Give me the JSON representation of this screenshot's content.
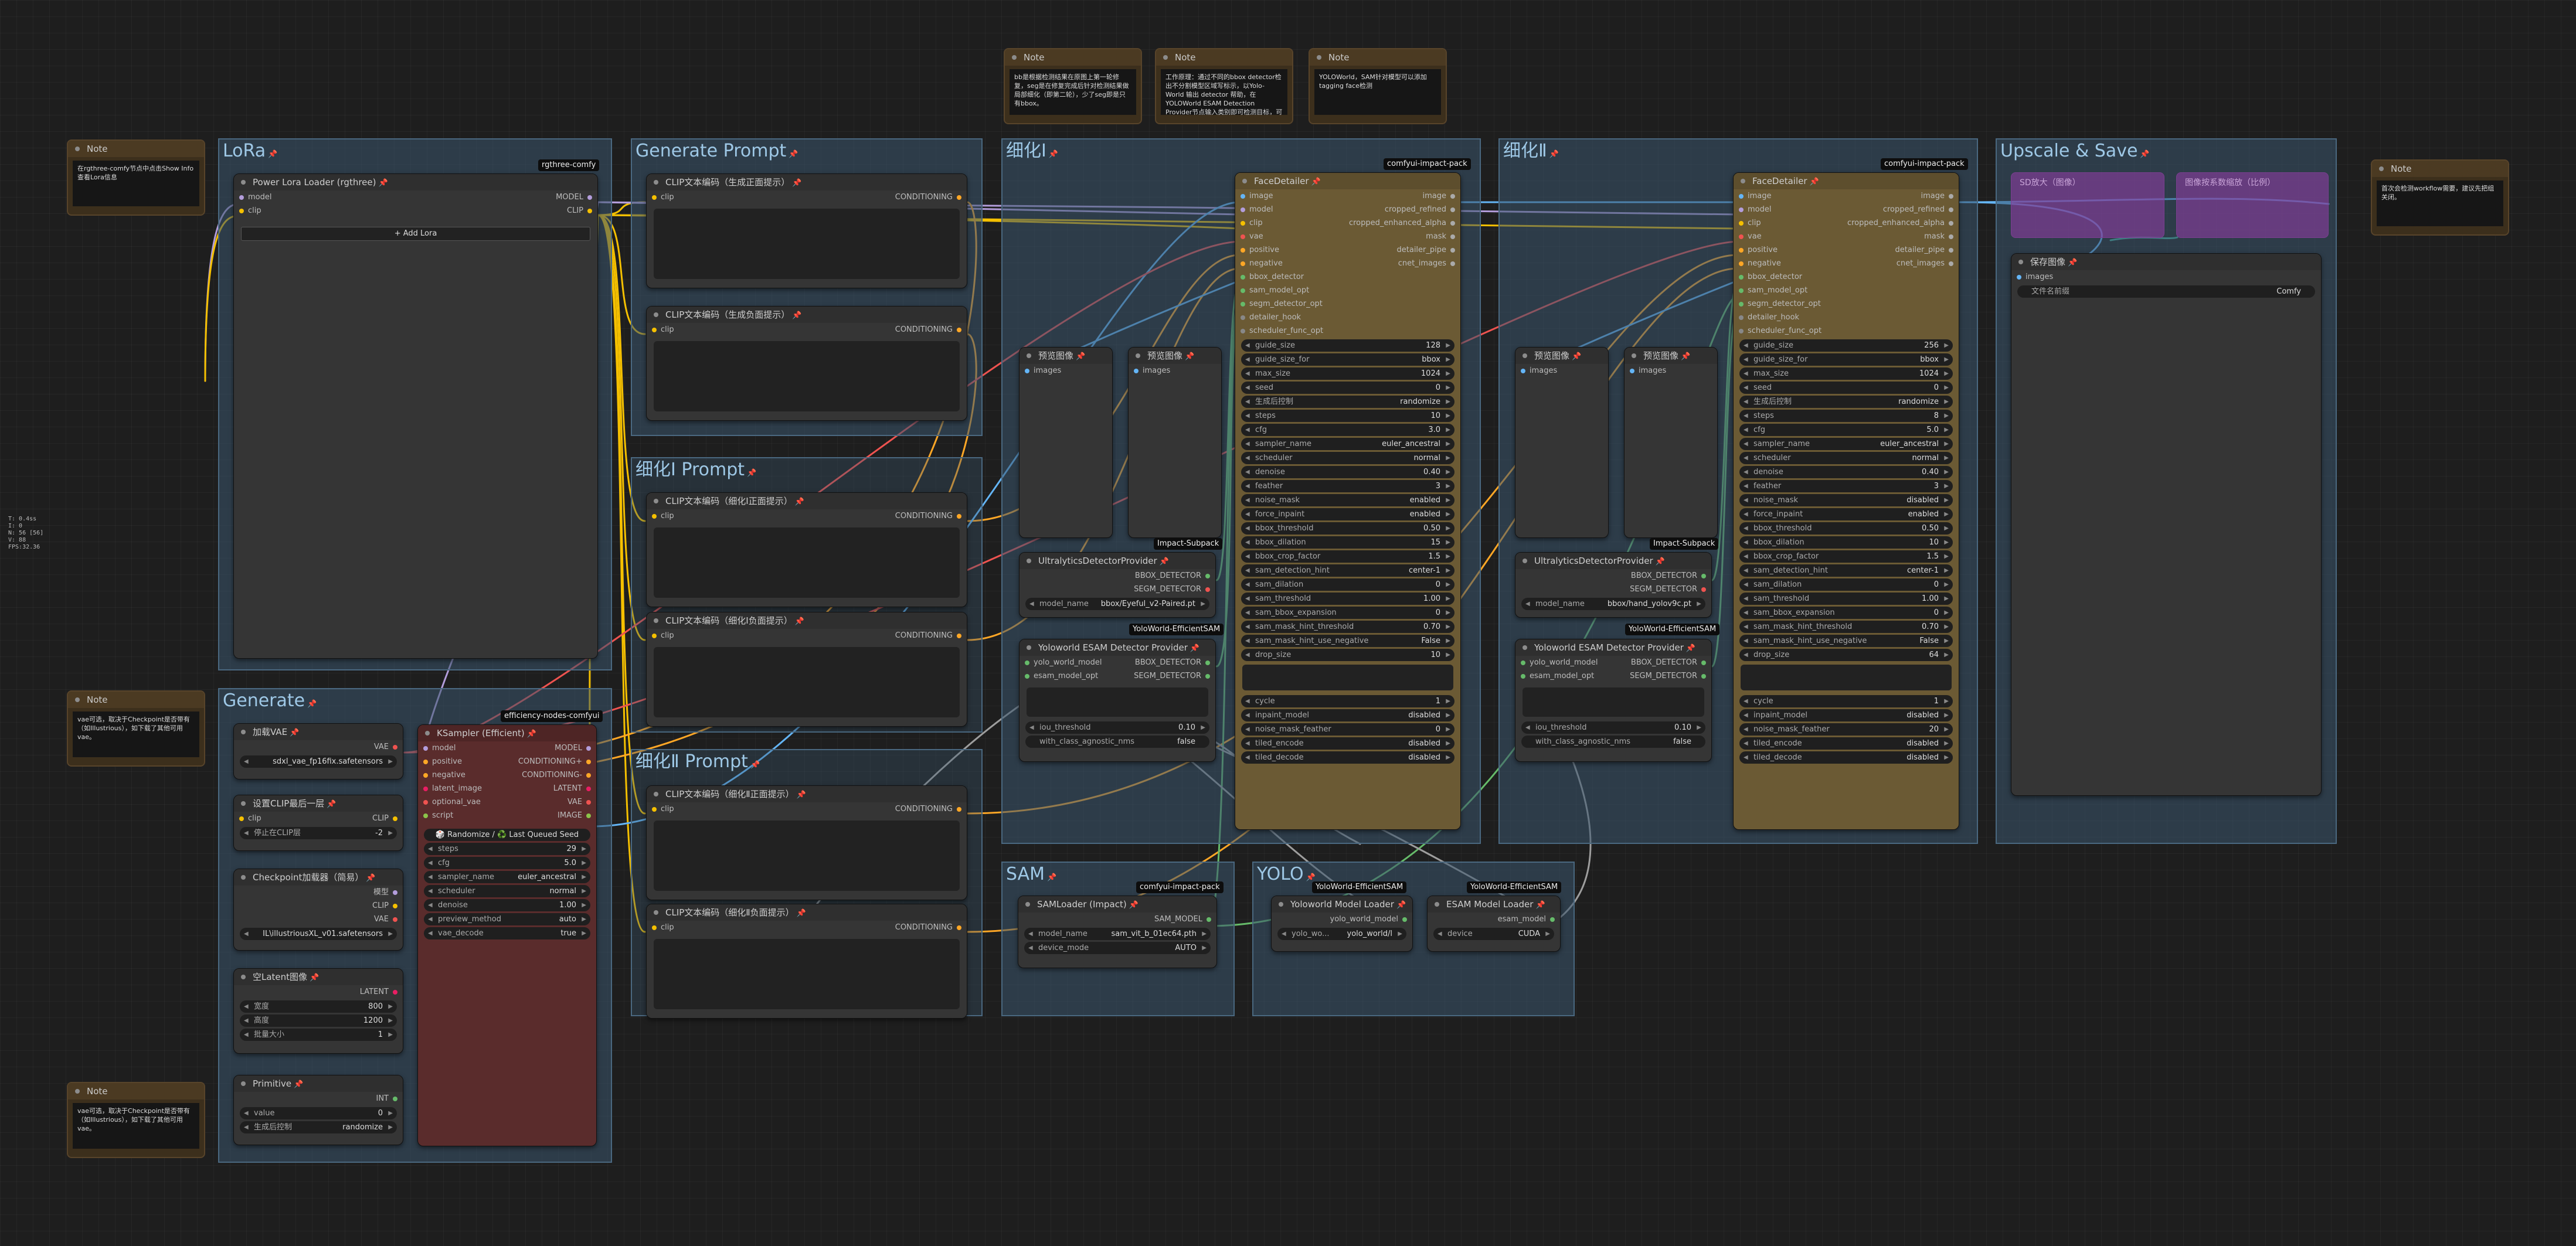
{
  "stats": {
    "line1": "T: 0.4ss",
    "line2": "I: 0",
    "line3": "N: 56 [56]",
    "line4": "V: 88",
    "line5": "FPS:32.36"
  },
  "groups": {
    "lora": "LoRa",
    "generate_prompt": "Generate Prompt",
    "refine1": "细化Ⅰ",
    "refine2": "细化Ⅱ",
    "upscale": "Upscale & Save",
    "refine1_prompt": "细化Ⅰ Prompt",
    "refine2_prompt": "细化Ⅱ Prompt",
    "generate": "Generate",
    "sam": "SAM",
    "yolo": "YOLO"
  },
  "notes": {
    "title": "Note",
    "top_left": "在rgthree-comfy节点中点击Show Info查看Lora信息",
    "mid_left": "vae可选，取决于Checkpoint是否带有（如Illustrious），如下载了其他可用vae。",
    "bot_left": "vae可选，取决于Checkpoint是否带有（如Illustrious），如下载了其他可用vae。",
    "top1": "bb是根据检测结果在原图上第一轮修复，seg是在修复完成后针对检测结果做局部细化（即第二轮），少了seg即是只有bbox。",
    "top2": "工作原理：通过不同的bbox detector检出不分割模型区域写标示，以Yolo-World 输出 detector 帮助，在YOLOWorld ESAM Detection Provider节点输入类别即可检测目标，可将其多个类目合并以逗号分隔。",
    "top3": "YOLOWorld，SAM针对模型可以添加tagging face检测",
    "right": "首次会检测workflow需要，建议先把组关闭。"
  },
  "badges": {
    "rgthree": "rgthree-comfy",
    "impact": "comfyui-impact-pack",
    "efficiency": "efficiency-nodes-comfyui",
    "impact_subpack": "Impact-Subpack",
    "yoloworld": "YoloWorld-EfficientSAM"
  },
  "lora": {
    "title": "Power Lora Loader (rgthree)",
    "in_model": "model",
    "in_clip": "clip",
    "out_model": "MODEL",
    "out_clip": "CLIP",
    "add_lora": "+ Add Lora"
  },
  "clip": {
    "pos_gen": "CLIP文本编码（生成正面提示）",
    "neg_gen": "CLIP文本编码（生成负面提示）",
    "pos_r1": "CLIP文本编码（细化Ⅰ正面提示）",
    "neg_r1": "CLIP文本编码（细化Ⅰ负面提示）",
    "pos_r2": "CLIP文本编码（细化Ⅱ正面提示）",
    "neg_r2": "CLIP文本编码（细化Ⅱ负面提示）",
    "in": "clip",
    "out": "CONDITIONING"
  },
  "generate": {
    "vae_loader": {
      "title": "加载VAE",
      "out": "VAE",
      "name": "sdxl_vae_fp16fix.safetensors"
    },
    "clip_skip": {
      "title": "设置CLIP最后一层",
      "in": "clip",
      "out": "CLIP",
      "label": "停止在CLIP层",
      "value": "-2"
    },
    "ckpt": {
      "title": "Checkpoint加载器（简易）",
      "out_model": "模型",
      "out_clip": "CLIP",
      "out_vae": "VAE",
      "name": "IL\\illustriousXL_v01.safetensors"
    },
    "latent": {
      "title": "空Latent图像",
      "out": "LATENT",
      "w_label": "宽度",
      "w": "800",
      "h_label": "高度",
      "h": "1200",
      "b_label": "批量大小",
      "b": "1"
    },
    "primitive": {
      "title": "Primitive",
      "out": "INT",
      "v_label": "value",
      "v": "0",
      "c_label": "生成后控制",
      "c": "randomize"
    }
  },
  "ksampler": {
    "title": "KSampler (Efficient)",
    "inputs": [
      "model",
      "positive",
      "negative",
      "latent_image",
      "optional_vae",
      "script"
    ],
    "outputs": [
      "MODEL",
      "CONDITIONING+",
      "CONDITIONING-",
      "LATENT",
      "VAE",
      "IMAGE"
    ],
    "seed_btn": "🎲 Randomize / ♻️ Last Queued Seed",
    "widgets": [
      {
        "l": "steps",
        "v": "29"
      },
      {
        "l": "cfg",
        "v": "5.0"
      },
      {
        "l": "sampler_name",
        "v": "euler_ancestral"
      },
      {
        "l": "scheduler",
        "v": "normal"
      },
      {
        "l": "denoise",
        "v": "1.00"
      },
      {
        "l": "preview_method",
        "v": "auto"
      },
      {
        "l": "vae_decode",
        "v": "true"
      }
    ]
  },
  "face1": {
    "title": "FaceDetailer",
    "inputs": [
      "image",
      "model",
      "clip",
      "vae",
      "positive",
      "negative",
      "bbox_detector",
      "sam_model_opt",
      "segm_detector_opt",
      "detailer_hook",
      "scheduler_func_opt"
    ],
    "outputs": [
      "image",
      "cropped_refined",
      "cropped_enhanced_alpha",
      "mask",
      "detailer_pipe",
      "cnet_images"
    ],
    "widgets": [
      {
        "l": "guide_size",
        "v": "128"
      },
      {
        "l": "guide_size_for",
        "v": "bbox"
      },
      {
        "l": "max_size",
        "v": "1024"
      },
      {
        "l": "seed",
        "v": "0"
      },
      {
        "l": "生成后控制",
        "v": "randomize"
      },
      {
        "l": "steps",
        "v": "10"
      },
      {
        "l": "cfg",
        "v": "3.0"
      },
      {
        "l": "sampler_name",
        "v": "euler_ancestral"
      },
      {
        "l": "scheduler",
        "v": "normal"
      },
      {
        "l": "denoise",
        "v": "0.40"
      },
      {
        "l": "feather",
        "v": "3"
      },
      {
        "l": "noise_mask",
        "v": "enabled"
      },
      {
        "l": "force_inpaint",
        "v": "enabled"
      },
      {
        "l": "bbox_threshold",
        "v": "0.50"
      },
      {
        "l": "bbox_dilation",
        "v": "15"
      },
      {
        "l": "bbox_crop_factor",
        "v": "1.5"
      },
      {
        "l": "sam_detection_hint",
        "v": "center-1"
      },
      {
        "l": "sam_dilation",
        "v": "0"
      },
      {
        "l": "sam_threshold",
        "v": "1.00"
      },
      {
        "l": "sam_bbox_expansion",
        "v": "0"
      },
      {
        "l": "sam_mask_hint_threshold",
        "v": "0.70"
      },
      {
        "l": "sam_mask_hint_use_negative",
        "v": "False"
      },
      {
        "l": "drop_size",
        "v": "10"
      }
    ],
    "tail": [
      {
        "l": "cycle",
        "v": "1"
      },
      {
        "l": "inpaint_model",
        "v": "disabled"
      },
      {
        "l": "noise_mask_feather",
        "v": "0"
      },
      {
        "l": "tiled_encode",
        "v": "disabled"
      },
      {
        "l": "tiled_decode",
        "v": "disabled"
      }
    ]
  },
  "face2": {
    "title": "FaceDetailer",
    "widgets": [
      {
        "l": "guide_size",
        "v": "256"
      },
      {
        "l": "guide_size_for",
        "v": "bbox"
      },
      {
        "l": "max_size",
        "v": "1024"
      },
      {
        "l": "seed",
        "v": "0"
      },
      {
        "l": "生成后控制",
        "v": "randomize"
      },
      {
        "l": "steps",
        "v": "8"
      },
      {
        "l": "cfg",
        "v": "5.0"
      },
      {
        "l": "sampler_name",
        "v": "euler_ancestral"
      },
      {
        "l": "scheduler",
        "v": "normal"
      },
      {
        "l": "denoise",
        "v": "0.40"
      },
      {
        "l": "feather",
        "v": "3"
      },
      {
        "l": "noise_mask",
        "v": "disabled"
      },
      {
        "l": "force_inpaint",
        "v": "enabled"
      },
      {
        "l": "bbox_threshold",
        "v": "0.50"
      },
      {
        "l": "bbox_dilation",
        "v": "10"
      },
      {
        "l": "bbox_crop_factor",
        "v": "1.5"
      },
      {
        "l": "sam_detection_hint",
        "v": "center-1"
      },
      {
        "l": "sam_dilation",
        "v": "0"
      },
      {
        "l": "sam_threshold",
        "v": "1.00"
      },
      {
        "l": "sam_bbox_expansion",
        "v": "0"
      },
      {
        "l": "sam_mask_hint_threshold",
        "v": "0.70"
      },
      {
        "l": "sam_mask_hint_use_negative",
        "v": "False"
      },
      {
        "l": "drop_size",
        "v": "64"
      }
    ],
    "tail": [
      {
        "l": "cycle",
        "v": "1"
      },
      {
        "l": "inpaint_model",
        "v": "disabled"
      },
      {
        "l": "noise_mask_feather",
        "v": "20"
      },
      {
        "l": "tiled_encode",
        "v": "disabled"
      },
      {
        "l": "tiled_decode",
        "v": "disabled"
      }
    ]
  },
  "preview": {
    "title": "预览图像",
    "in": "images"
  },
  "ultra": {
    "title": "UltralyticsDetectorProvider",
    "out1": "BBOX_DETECTOR",
    "out2": "SEGM_DETECTOR",
    "model_label": "model_name",
    "model1": "bbox/Eyeful_v2-Paired.pt",
    "model2": "bbox/hand_yolov9c.pt"
  },
  "yolo_esam": {
    "title": "Yoloworld ESAM Detector Provider",
    "in1": "yolo_world_model",
    "in2": "esam_model_opt",
    "out1": "BBOX_DETECTOR",
    "out2": "SEGM_DETECTOR",
    "iou_label": "iou_threshold",
    "iou": "0.10",
    "agn_label": "with_class_agnostic_nms",
    "agn": "false"
  },
  "sam_loader": {
    "title": "SAMLoader (Impact)",
    "out": "SAM_MODEL",
    "m_label": "model_name",
    "m": "sam_vit_b_01ec64.pth",
    "d_label": "device_mode",
    "d": "AUTO"
  },
  "yolo_loader": {
    "title": "Yoloworld Model Loader",
    "out": "yolo_world_model",
    "l": "yolo_wo...",
    "v": "yolo_world/l"
  },
  "esam_loader": {
    "title": "ESAM Model Loader",
    "out": "esam_model",
    "l": "device",
    "v": "CUDA"
  },
  "save": {
    "title": "保存图像",
    "in": "images",
    "l": "文件名前缀",
    "v": "Comfy"
  },
  "upscale_faded": {
    "a": "SD放大（图像）",
    "b": "图像按系数缩放（比例）"
  }
}
